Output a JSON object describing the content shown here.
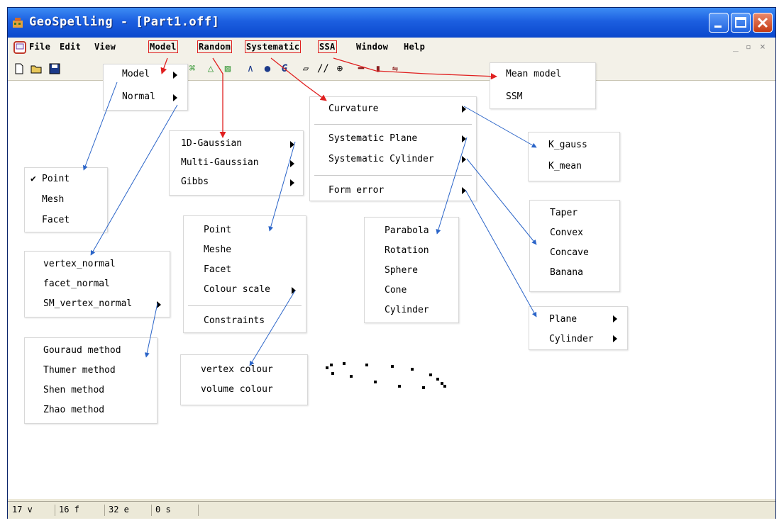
{
  "window": {
    "title": "GeoSpelling - [Part1.off]"
  },
  "menubar": {
    "items": [
      "File",
      "Edit",
      "View",
      "Model",
      "Random",
      "Systematic",
      "SSA",
      "Window",
      "Help"
    ]
  },
  "status": [
    "17 v",
    "16 f",
    "32 e",
    "0 s"
  ],
  "menus": {
    "model": [
      "Model",
      "Normal"
    ],
    "ssa": [
      "Mean model",
      "SSM"
    ],
    "systematic": [
      "Curvature",
      "Systematic Plane",
      "Systematic Cylinder",
      "Form error"
    ],
    "random": [
      "1D-Gaussian",
      "Multi-Gaussian",
      "Gibbs"
    ],
    "curvature": [
      "K_gauss",
      "K_mean"
    ],
    "model_sub": [
      "Point",
      "Mesh",
      "Facet"
    ],
    "model_sub_check": "✔",
    "random_sub": [
      "Point",
      "Meshe",
      "Facet",
      "Colour scale",
      "Constraints"
    ],
    "plane": [
      "Parabola",
      "Rotation",
      "Sphere",
      "Cone",
      "Cylinder"
    ],
    "cylinder": [
      "Taper",
      "Convex",
      "Concave",
      "Banana"
    ],
    "normal_sub": [
      "vertex_normal",
      "facet_normal",
      "SM_vertex_normal"
    ],
    "form_error": [
      "Plane",
      "Cylinder"
    ],
    "sm_normal_methods": [
      "Gouraud method",
      "Thumer method",
      "Shen method",
      "Zhao method"
    ],
    "colour_scale": [
      "vertex colour",
      "volume colour"
    ]
  },
  "colors": {
    "red_arrow": "#e02020",
    "blue_arrow": "#2a64c8",
    "title_bar": "#1c5fe0"
  },
  "icons": [
    "new-file-icon",
    "open-folder-icon",
    "save-icon"
  ]
}
